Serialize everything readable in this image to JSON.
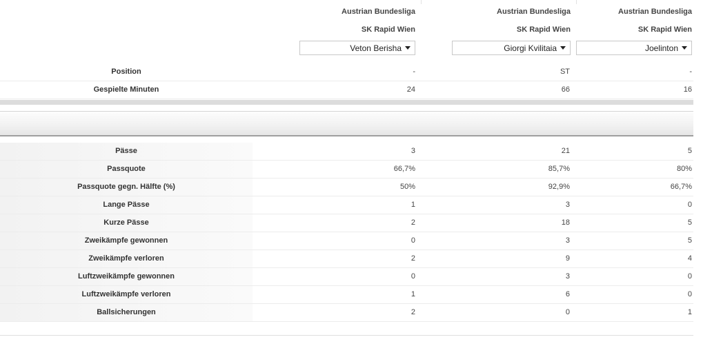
{
  "players": [
    {
      "league": "Austrian Bundesliga",
      "club": "SK Rapid Wien",
      "name": "Veton Berisha"
    },
    {
      "league": "Austrian Bundesliga",
      "club": "SK Rapid Wien",
      "name": "Giorgi Kvilitaia"
    },
    {
      "league": "Austrian Bundesliga",
      "club": "SK Rapid Wien",
      "name": "Joelinton"
    }
  ],
  "top_rows": [
    {
      "label": "Position",
      "values": [
        "-",
        "ST",
        "-"
      ]
    },
    {
      "label": "Gespielte Minuten",
      "values": [
        "24",
        "66",
        "16"
      ]
    }
  ],
  "stat_rows": [
    {
      "label": "Pässe",
      "values": [
        "3",
        "21",
        "5"
      ]
    },
    {
      "label": "Passquote",
      "values": [
        "66,7%",
        "85,7%",
        "80%"
      ]
    },
    {
      "label": "Passquote gegn. Hälfte (%)",
      "values": [
        "50%",
        "92,9%",
        "66,7%"
      ]
    },
    {
      "label": "Lange Pässe",
      "values": [
        "1",
        "3",
        "0"
      ]
    },
    {
      "label": "Kurze Pässe",
      "values": [
        "2",
        "18",
        "5"
      ]
    },
    {
      "label": "Zweikämpfe gewonnen",
      "values": [
        "0",
        "3",
        "5"
      ]
    },
    {
      "label": "Zweikämpfe verloren",
      "values": [
        "2",
        "9",
        "4"
      ]
    },
    {
      "label": "Luftzweikämpfe gewonnen",
      "values": [
        "0",
        "3",
        "0"
      ]
    },
    {
      "label": "Luftzweikämpfe verloren",
      "values": [
        "1",
        "6",
        "0"
      ]
    },
    {
      "label": "Ballsicherungen",
      "values": [
        "2",
        "0",
        "1"
      ]
    }
  ]
}
